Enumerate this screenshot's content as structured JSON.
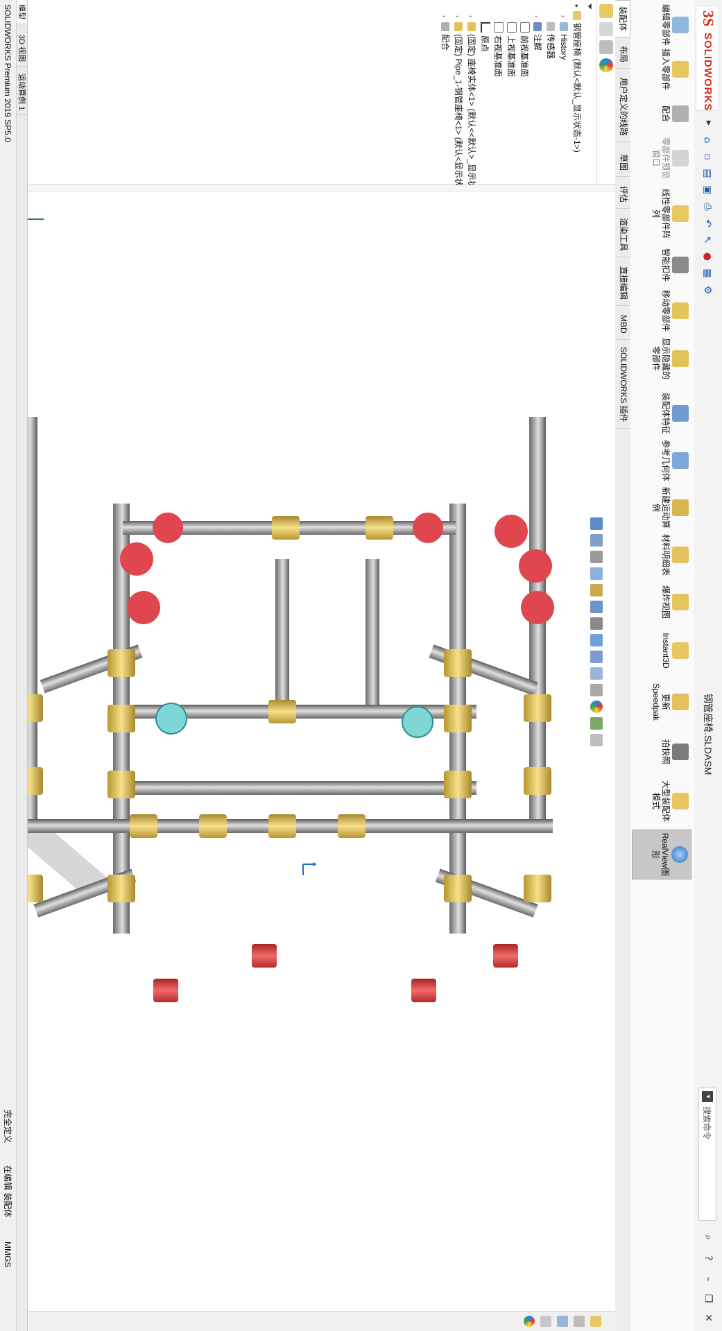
{
  "app": {
    "logo_text": "SOLIDWORKS",
    "document_title": "钢管座椅.SLDASM",
    "search_placeholder": "搜索命令"
  },
  "command_manager": {
    "tools": [
      {
        "label": "编辑零部件"
      },
      {
        "label": "插入零部件"
      },
      {
        "label": "配合"
      },
      {
        "label": "零部件预览窗口"
      },
      {
        "label": "线性零部件阵列"
      },
      {
        "label": "智能扣件"
      },
      {
        "label": "移动零部件"
      },
      {
        "label": "显示隐藏的零部件"
      },
      {
        "label": "装配体特征"
      },
      {
        "label": "参考几何体"
      },
      {
        "label": "新建运动算例"
      },
      {
        "label": "材料明细表"
      },
      {
        "label": "爆炸视图"
      },
      {
        "label": "Instant3D"
      },
      {
        "label": "更新Speedpak"
      },
      {
        "label": "拍快照"
      },
      {
        "label": "大型装配体模式"
      },
      {
        "label": "RealView图形"
      }
    ]
  },
  "tabs": [
    {
      "label": "装配体"
    },
    {
      "label": "布局"
    },
    {
      "label": "用户定义的线路"
    },
    {
      "label": "草图"
    },
    {
      "label": "评估"
    },
    {
      "label": "渲染工具"
    },
    {
      "label": "直接编辑"
    },
    {
      "label": "MBD"
    },
    {
      "label": "SOLIDWORKS 插件"
    }
  ],
  "feature_tree": {
    "nodes": [
      {
        "label": "钢管座椅 (默认<默认_显示状态-1>)"
      },
      {
        "label": "History"
      },
      {
        "label": "传感器"
      },
      {
        "label": "注解"
      },
      {
        "label": "前视基准面"
      },
      {
        "label": "上视基准面"
      },
      {
        "label": "右视基准面"
      },
      {
        "label": "原点"
      },
      {
        "label": "(固定) 座椅实体<1> (默认<<默认>_显示状态 1>)"
      },
      {
        "label": "(固定) Pipe_1-钢管座椅<1> (默认<显示状态-1>)"
      },
      {
        "label": "配合"
      }
    ]
  },
  "bottom_tabs": [
    {
      "label": "模型"
    },
    {
      "label": "3D 视图"
    },
    {
      "label": "运动算例 1"
    }
  ],
  "status_bar": {
    "version": "SOLIDWORKS Premium 2019 SP5.0",
    "state": "完全定义",
    "mode": "在编辑 装配体",
    "units": "MMGS"
  },
  "colors": {
    "logo_red": "#d32a1f",
    "pipe_gray": "#9a9a9a",
    "fitting_yellow": "#e8c85a",
    "foot_red": "#d93b3b",
    "elbow_red": "#e0464d",
    "elbow_cyan": "#7fd6d6",
    "selection_blue": "#1f6fc2"
  },
  "icons": {
    "triad": "coordinate-triad-icon",
    "origin": "origin-icon"
  }
}
